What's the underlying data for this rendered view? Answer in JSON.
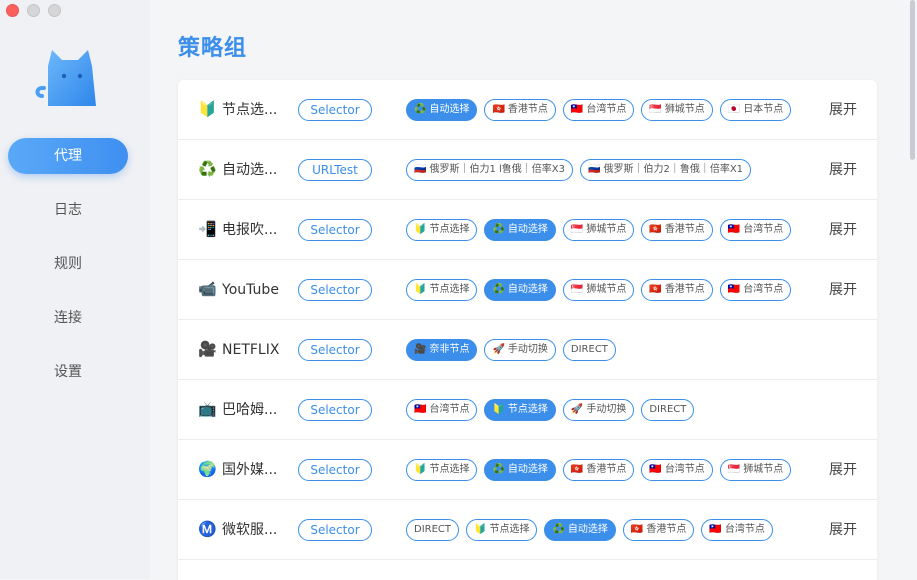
{
  "sidebar": {
    "items": [
      {
        "label": "代理",
        "active": true
      },
      {
        "label": "日志",
        "active": false
      },
      {
        "label": "规则",
        "active": false
      },
      {
        "label": "连接",
        "active": false
      },
      {
        "label": "设置",
        "active": false
      }
    ]
  },
  "page": {
    "title": "策略组"
  },
  "groups": [
    {
      "icon": "🔰",
      "name": "节点选...",
      "type": "Selector",
      "expand": "展开",
      "chips": [
        {
          "flag": "♻️",
          "label": "自动选择",
          "selected": true
        },
        {
          "flag": "🇭🇰",
          "label": "香港节点",
          "selected": false
        },
        {
          "flag": "🇹🇼",
          "label": "台湾节点",
          "selected": false
        },
        {
          "flag": "🇸🇬",
          "label": "狮城节点",
          "selected": false
        },
        {
          "flag": "🇯🇵",
          "label": "日本节点",
          "selected": false
        }
      ]
    },
    {
      "icon": "♻️",
      "name": "自动选...",
      "type": "URLTest",
      "expand": "展开",
      "chips": [
        {
          "flag": "🇷🇺",
          "label": "俄罗斯｜伯力1 l鲁俄｜倍率X3",
          "selected": false
        },
        {
          "flag": "🇷🇺",
          "label": "俄罗斯｜伯力2｜鲁俄｜倍率X1",
          "selected": false
        }
      ]
    },
    {
      "icon": "📲",
      "name": "电报吹...",
      "type": "Selector",
      "expand": "展开",
      "chips": [
        {
          "flag": "🔰",
          "label": "节点选择",
          "selected": false
        },
        {
          "flag": "♻️",
          "label": "自动选择",
          "selected": true
        },
        {
          "flag": "🇸🇬",
          "label": "狮城节点",
          "selected": false
        },
        {
          "flag": "🇭🇰",
          "label": "香港节点",
          "selected": false
        },
        {
          "flag": "🇹🇼",
          "label": "台湾节点",
          "selected": false
        }
      ]
    },
    {
      "icon": "📹",
      "name": "YouTube",
      "type": "Selector",
      "expand": "展开",
      "chips": [
        {
          "flag": "🔰",
          "label": "节点选择",
          "selected": false
        },
        {
          "flag": "♻️",
          "label": "自动选择",
          "selected": true
        },
        {
          "flag": "🇸🇬",
          "label": "狮城节点",
          "selected": false
        },
        {
          "flag": "🇭🇰",
          "label": "香港节点",
          "selected": false
        },
        {
          "flag": "🇹🇼",
          "label": "台湾节点",
          "selected": false
        }
      ]
    },
    {
      "icon": "🎥",
      "name": "NETFLIX",
      "type": "Selector",
      "expand": "",
      "chips": [
        {
          "flag": "🎥",
          "label": "奈非节点",
          "selected": true
        },
        {
          "flag": "🚀",
          "label": "手动切换",
          "selected": false
        },
        {
          "flag": "",
          "label": "DIRECT",
          "selected": false
        }
      ]
    },
    {
      "icon": "📺",
      "name": "巴哈姆...",
      "type": "Selector",
      "expand": "",
      "chips": [
        {
          "flag": "🇹🇼",
          "label": "台湾节点",
          "selected": false
        },
        {
          "flag": "🔰",
          "label": "节点选择",
          "selected": true
        },
        {
          "flag": "🚀",
          "label": "手动切换",
          "selected": false
        },
        {
          "flag": "",
          "label": "DIRECT",
          "selected": false
        }
      ]
    },
    {
      "icon": "🌍",
      "name": "国外媒...",
      "type": "Selector",
      "expand": "展开",
      "chips": [
        {
          "flag": "🔰",
          "label": "节点选择",
          "selected": false
        },
        {
          "flag": "♻️",
          "label": "自动选择",
          "selected": true
        },
        {
          "flag": "🇭🇰",
          "label": "香港节点",
          "selected": false
        },
        {
          "flag": "🇹🇼",
          "label": "台湾节点",
          "selected": false
        },
        {
          "flag": "🇸🇬",
          "label": "狮城节点",
          "selected": false
        }
      ]
    },
    {
      "icon": "Ⓜ️",
      "name": "微软服...",
      "type": "Selector",
      "expand": "展开",
      "chips": [
        {
          "flag": "",
          "label": "DIRECT",
          "selected": false
        },
        {
          "flag": "🔰",
          "label": "节点选择",
          "selected": false
        },
        {
          "flag": "♻️",
          "label": "自动选择",
          "selected": true
        },
        {
          "flag": "🇭🇰",
          "label": "香港节点",
          "selected": false
        },
        {
          "flag": "🇹🇼",
          "label": "台湾节点",
          "selected": false
        }
      ]
    }
  ]
}
